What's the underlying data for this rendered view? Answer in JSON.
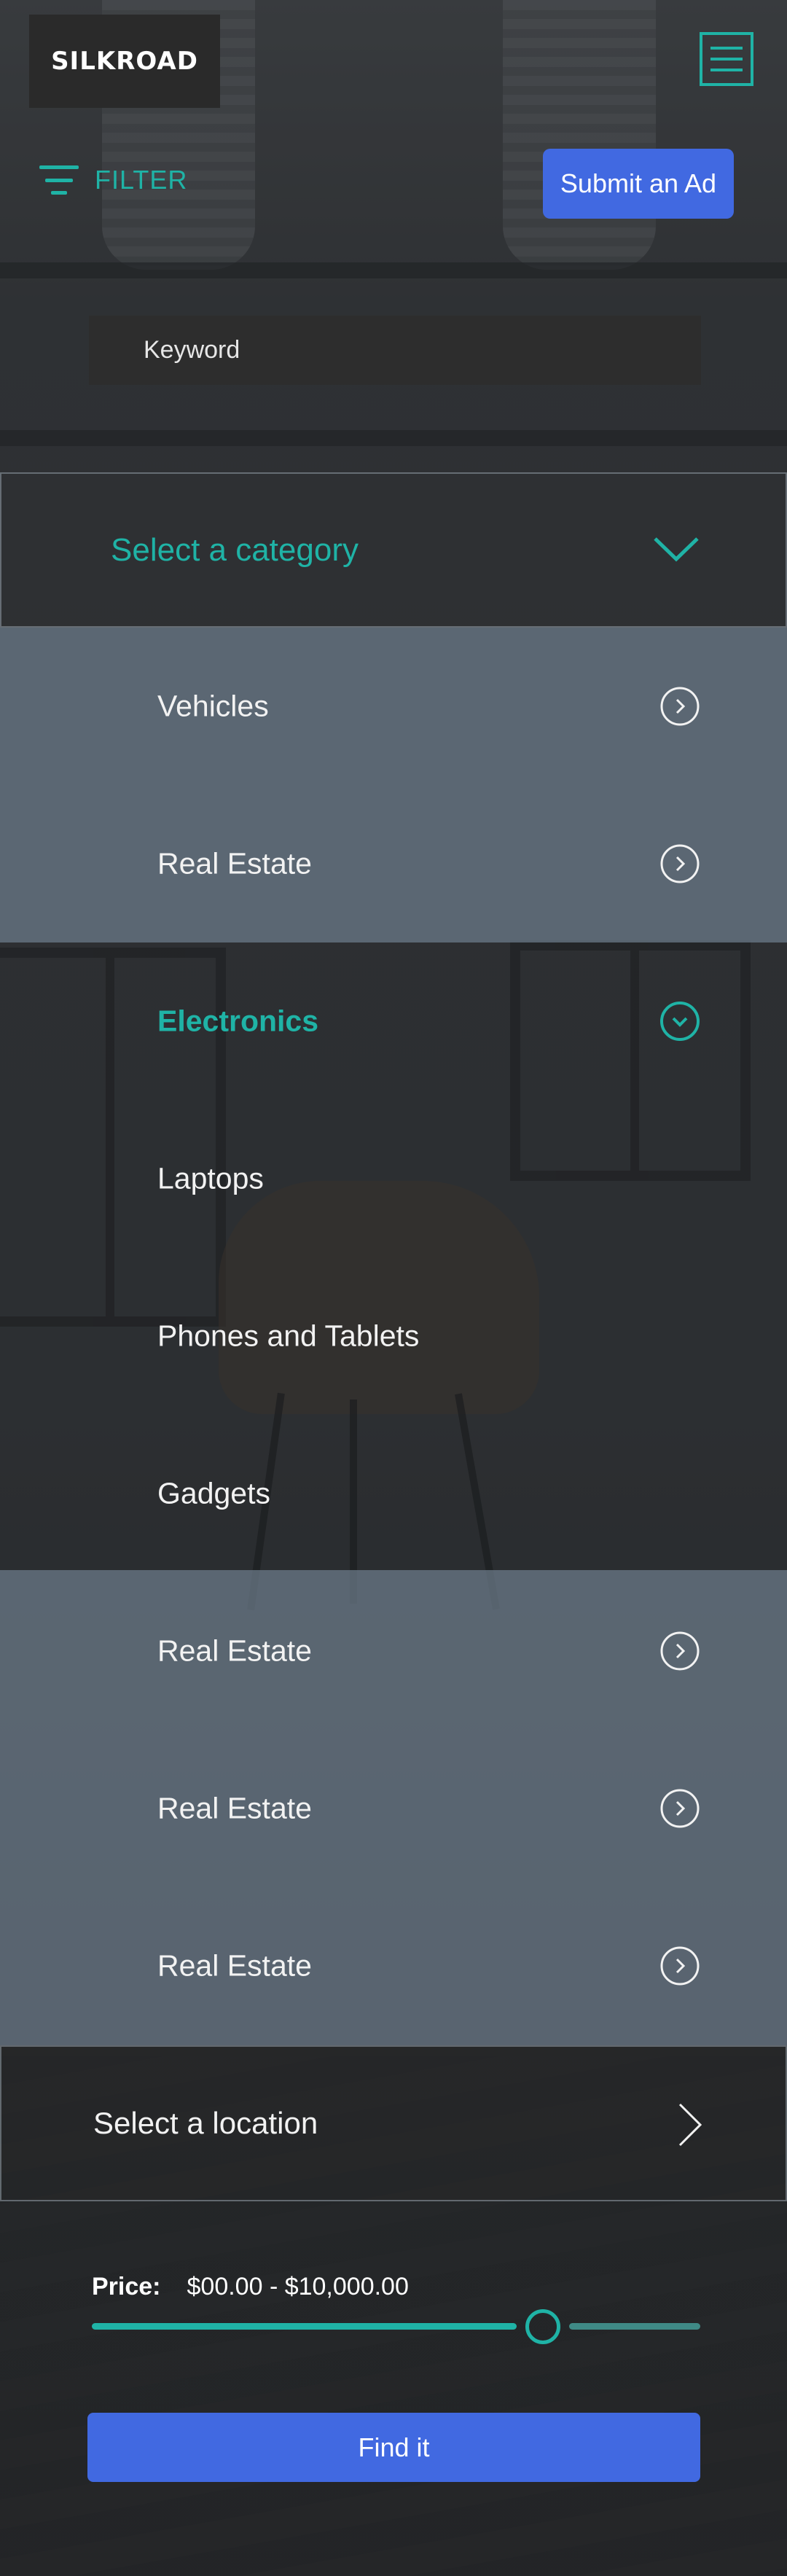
{
  "header": {
    "logo": "SILKROAD",
    "submit_label": "Submit an Ad"
  },
  "filter": {
    "label": "FILTER"
  },
  "search": {
    "placeholder": "Keyword"
  },
  "category": {
    "title": "Select a category",
    "items": [
      {
        "label": "Vehicles",
        "icon": "chevron-right-circle-icon"
      },
      {
        "label": "Real Estate",
        "icon": "chevron-right-circle-icon"
      },
      {
        "label": "Electronics",
        "icon": "chevron-down-circle-icon",
        "expanded": true
      },
      {
        "label": "Laptops"
      },
      {
        "label": "Phones and Tablets"
      },
      {
        "label": "Gadgets"
      },
      {
        "label": "Real Estate",
        "icon": "chevron-right-circle-icon"
      },
      {
        "label": "Real Estate",
        "icon": "chevron-right-circle-icon"
      },
      {
        "label": "Real Estate",
        "icon": "chevron-right-circle-icon"
      }
    ]
  },
  "location": {
    "label": "Select a location"
  },
  "price": {
    "label": "Price:",
    "range": "$00.00 - $10,000.00",
    "slider_fraction": 0.73
  },
  "find_label": "Find it",
  "colors": {
    "accent": "#1fb3a6",
    "primary": "#4169e1"
  }
}
